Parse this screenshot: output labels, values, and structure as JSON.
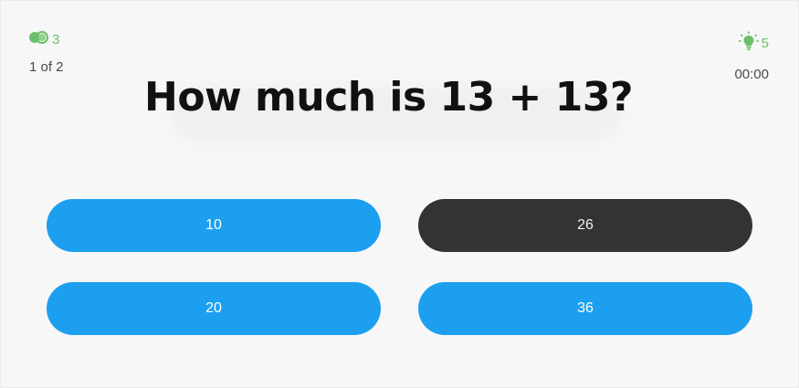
{
  "header": {
    "coins_count": "3",
    "progress": "1 of 2",
    "hints_count": "5",
    "timer": "00:00",
    "accent_color": "#6abf69"
  },
  "question": {
    "text": "How much is 13 + 13?"
  },
  "answers": [
    {
      "label": "10",
      "color": "#1d9ff0"
    },
    {
      "label": "26",
      "color": "#333333",
      "selected": true
    },
    {
      "label": "20",
      "color": "#1d9ff0"
    },
    {
      "label": "36",
      "color": "#1d9ff0"
    }
  ],
  "icons": {
    "coins": "coins-icon",
    "hint": "lightbulb-icon"
  }
}
